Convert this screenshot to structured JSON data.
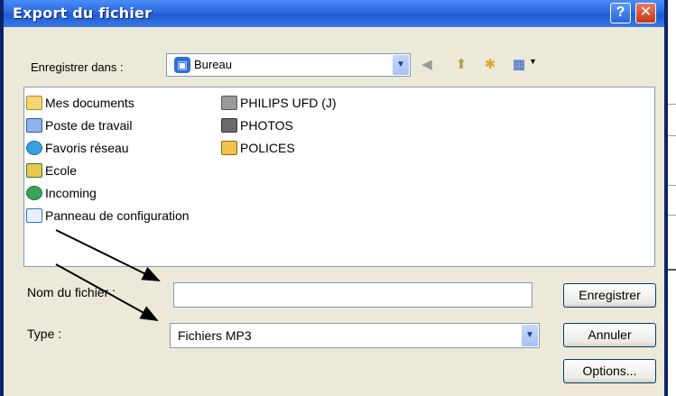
{
  "window": {
    "title": "Export du fichier"
  },
  "lookin": {
    "label": "Enregistrer dans :",
    "value": "Bureau"
  },
  "files": {
    "column1": [
      "Mes documents",
      "Poste de travail",
      "Favoris réseau",
      "Ecole",
      "Incoming",
      "Panneau de configuration"
    ],
    "column2": [
      "PHILIPS UFD (J)",
      "PHOTOS",
      "POLICES"
    ]
  },
  "filename": {
    "label": "Nom du fichier :",
    "value": ""
  },
  "filetype": {
    "label": "Type :",
    "value": "Fichiers MP3"
  },
  "buttons": {
    "save": "Enregistrer",
    "cancel": "Annuler",
    "options": "Options..."
  }
}
